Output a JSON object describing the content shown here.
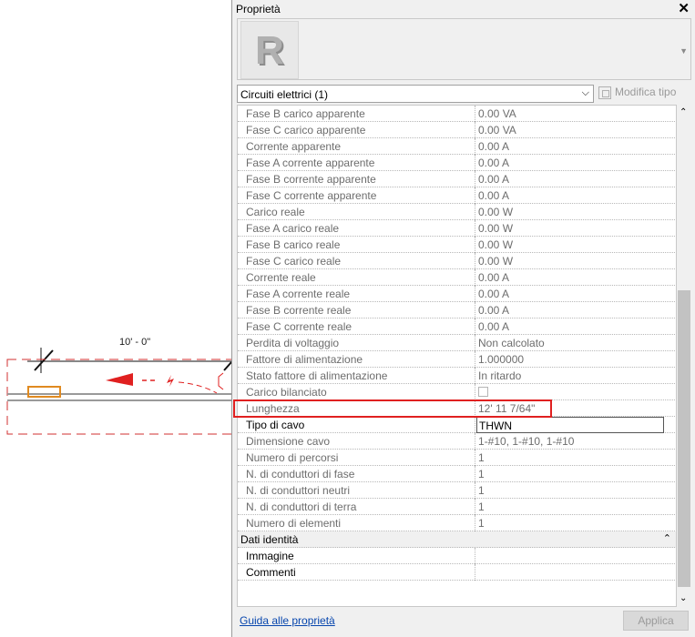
{
  "canvas": {
    "dimension_label": "10' - 0\""
  },
  "panel": {
    "title": "Proprietà",
    "close_icon": "close-icon",
    "type_selector_logo": "revit-R-logo",
    "category_selector": "Circuiti elettrici (1)",
    "edit_type_label": "Modifica tipo",
    "rows": [
      {
        "name": "Fase B carico apparente",
        "value": "0.00 VA"
      },
      {
        "name": "Fase C carico apparente",
        "value": "0.00 VA"
      },
      {
        "name": "Corrente apparente",
        "value": "0.00 A"
      },
      {
        "name": "Fase A corrente apparente",
        "value": "0.00 A"
      },
      {
        "name": "Fase B corrente apparente",
        "value": "0.00 A"
      },
      {
        "name": "Fase C corrente apparente",
        "value": "0.00 A"
      },
      {
        "name": "Carico reale",
        "value": "0.00 W"
      },
      {
        "name": "Fase A carico reale",
        "value": "0.00 W"
      },
      {
        "name": "Fase B carico reale",
        "value": "0.00 W"
      },
      {
        "name": "Fase C carico reale",
        "value": "0.00 W"
      },
      {
        "name": "Corrente reale",
        "value": "0.00 A"
      },
      {
        "name": "Fase A corrente reale",
        "value": "0.00 A"
      },
      {
        "name": "Fase B corrente reale",
        "value": "0.00 A"
      },
      {
        "name": "Fase C corrente reale",
        "value": "0.00 A"
      },
      {
        "name": "Perdita di voltaggio",
        "value": "Non calcolato"
      },
      {
        "name": "Fattore di alimentazione",
        "value": "1.000000"
      },
      {
        "name": "Stato fattore di alimentazione",
        "value": "In ritardo"
      },
      {
        "name": "Carico bilanciato",
        "value": ""
      },
      {
        "name": "Lunghezza",
        "value": "12'  11 7/64\""
      },
      {
        "name": "Tipo di cavo",
        "value": "THWN"
      },
      {
        "name": "Dimensione cavo",
        "value": "1-#10, 1-#10, 1-#10"
      },
      {
        "name": "Numero di percorsi",
        "value": "1"
      },
      {
        "name": "N. di conduttori di fase",
        "value": "1"
      },
      {
        "name": "N. di conduttori neutri",
        "value": "1"
      },
      {
        "name": "N. di conduttori di terra",
        "value": "1"
      },
      {
        "name": "Numero di elementi",
        "value": "1"
      }
    ],
    "section_identity": "Dati identità",
    "identity_rows": [
      {
        "name": "Immagine",
        "value": ""
      },
      {
        "name": "Commenti",
        "value": ""
      }
    ],
    "help_link": "Guida alle proprietà",
    "apply_button": "Applica"
  }
}
